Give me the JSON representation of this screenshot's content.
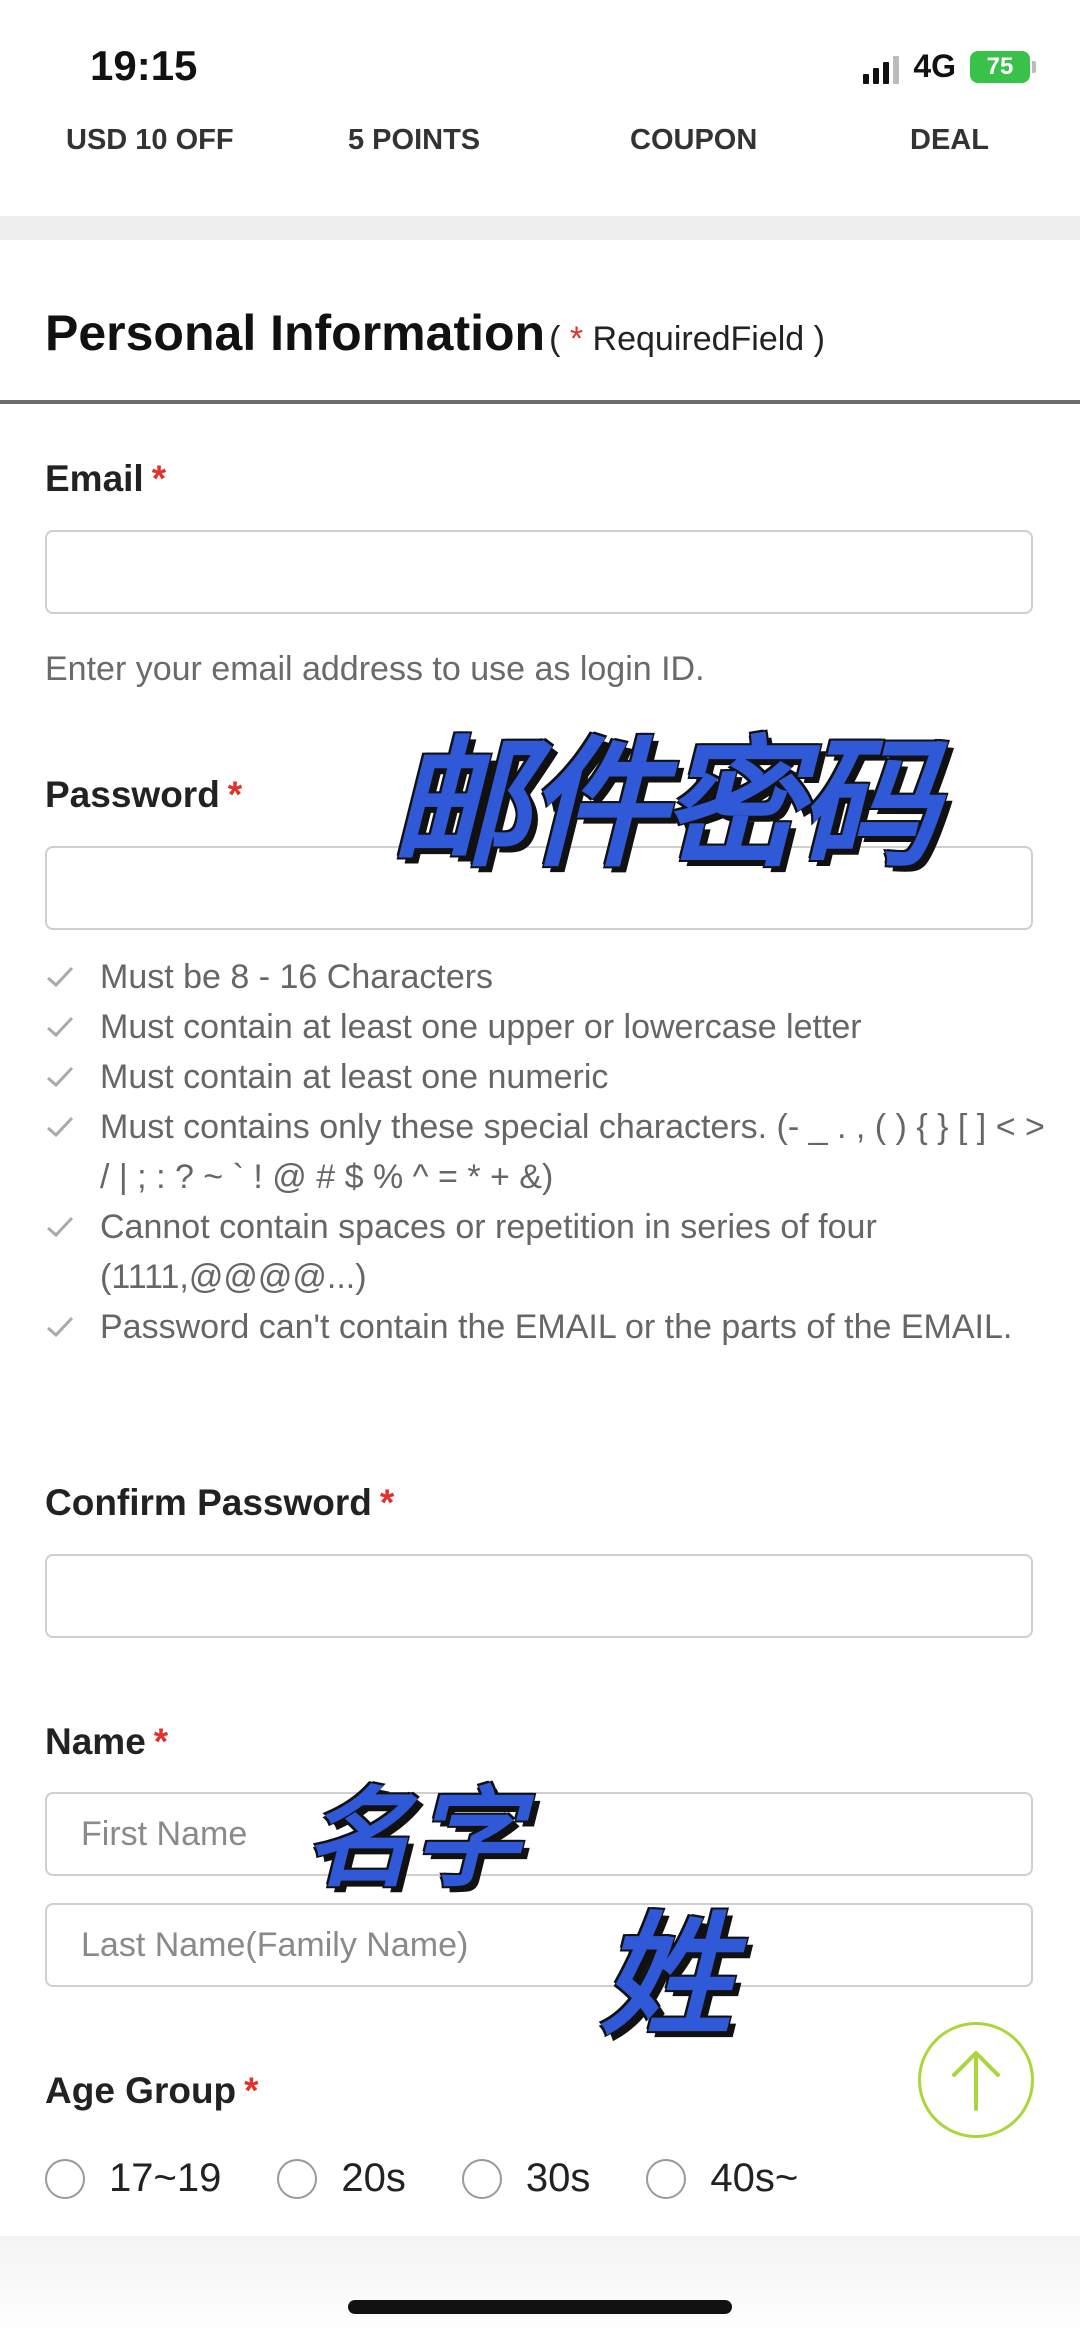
{
  "status_bar": {
    "time": "19:15",
    "network": "4G",
    "battery": "75"
  },
  "promo_tabs": [
    "USD 10 OFF",
    "5 POINTS",
    "COUPON",
    "DEAL"
  ],
  "section": {
    "title": "Personal Information",
    "required_open": "( ",
    "required_star": "*",
    "required_text": " RequiredField )"
  },
  "email": {
    "label": "Email",
    "star": "*",
    "value": "",
    "placeholder": "",
    "hint": "Enter your email address to use as login ID."
  },
  "password": {
    "label": "Password",
    "star": "*",
    "value": "",
    "placeholder": "",
    "rules": [
      "Must be 8 - 16 Characters",
      "Must contain at least one upper or lowercase letter",
      "Must contain at least one numeric",
      "Must contains only these special characters. (- _ . , ( ) { } [ ] < > / | ; : ? ~ ` ! @ # $ % ^ = * + &)",
      "Cannot contain spaces or repetition in series of four (1111,@@@@...)",
      "Password can't contain the EMAIL or the parts of the EMAIL."
    ]
  },
  "confirm_password": {
    "label": "Confirm Password",
    "star": "*",
    "value": ""
  },
  "name": {
    "label": "Name",
    "star": "*",
    "first_placeholder": "First Name",
    "last_placeholder": "Last Name(Family Name)"
  },
  "age_group": {
    "label": "Age Group",
    "star": "*",
    "options": [
      "17~19",
      "20s",
      "30s",
      "40s~"
    ]
  },
  "overlays": {
    "email_password": "邮件密码",
    "first_name": "名字",
    "last_name": "姓"
  },
  "colors": {
    "required_star": "#e0312d",
    "scroll_top_ring": "#a9d63b",
    "overlay_blue": "#2f59d6",
    "battery_green": "#39c24a"
  },
  "icons": {
    "check": "check-icon",
    "scroll_top": "arrow-up-icon"
  }
}
